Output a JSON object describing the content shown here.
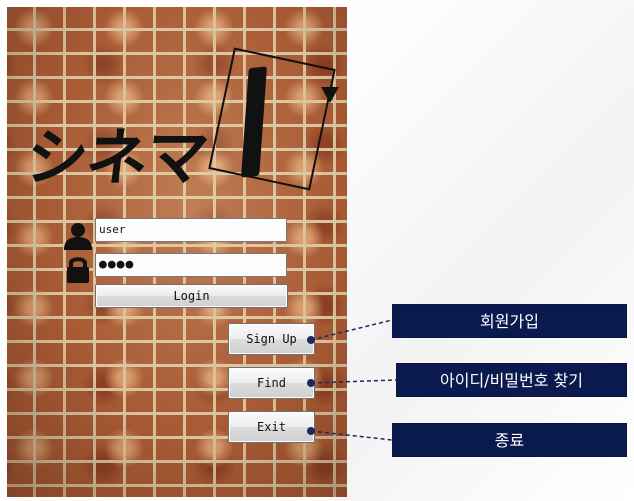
{
  "logo": {
    "text": "シネマ"
  },
  "login_form": {
    "user_icon": "user-icon",
    "lock_icon": "lock-icon",
    "username_value": "user",
    "password_mask": "●●●●",
    "login_label": "Login"
  },
  "side_buttons": {
    "signup_label": "Sign Up",
    "find_label": "Find",
    "exit_label": "Exit"
  },
  "annotations": {
    "signup": "회원가입",
    "find": "아이디/비밀번호 찾기",
    "exit": "종료"
  },
  "colors": {
    "callout_bg": "#0b1a4e",
    "leader_line": "#1a2b5b"
  }
}
